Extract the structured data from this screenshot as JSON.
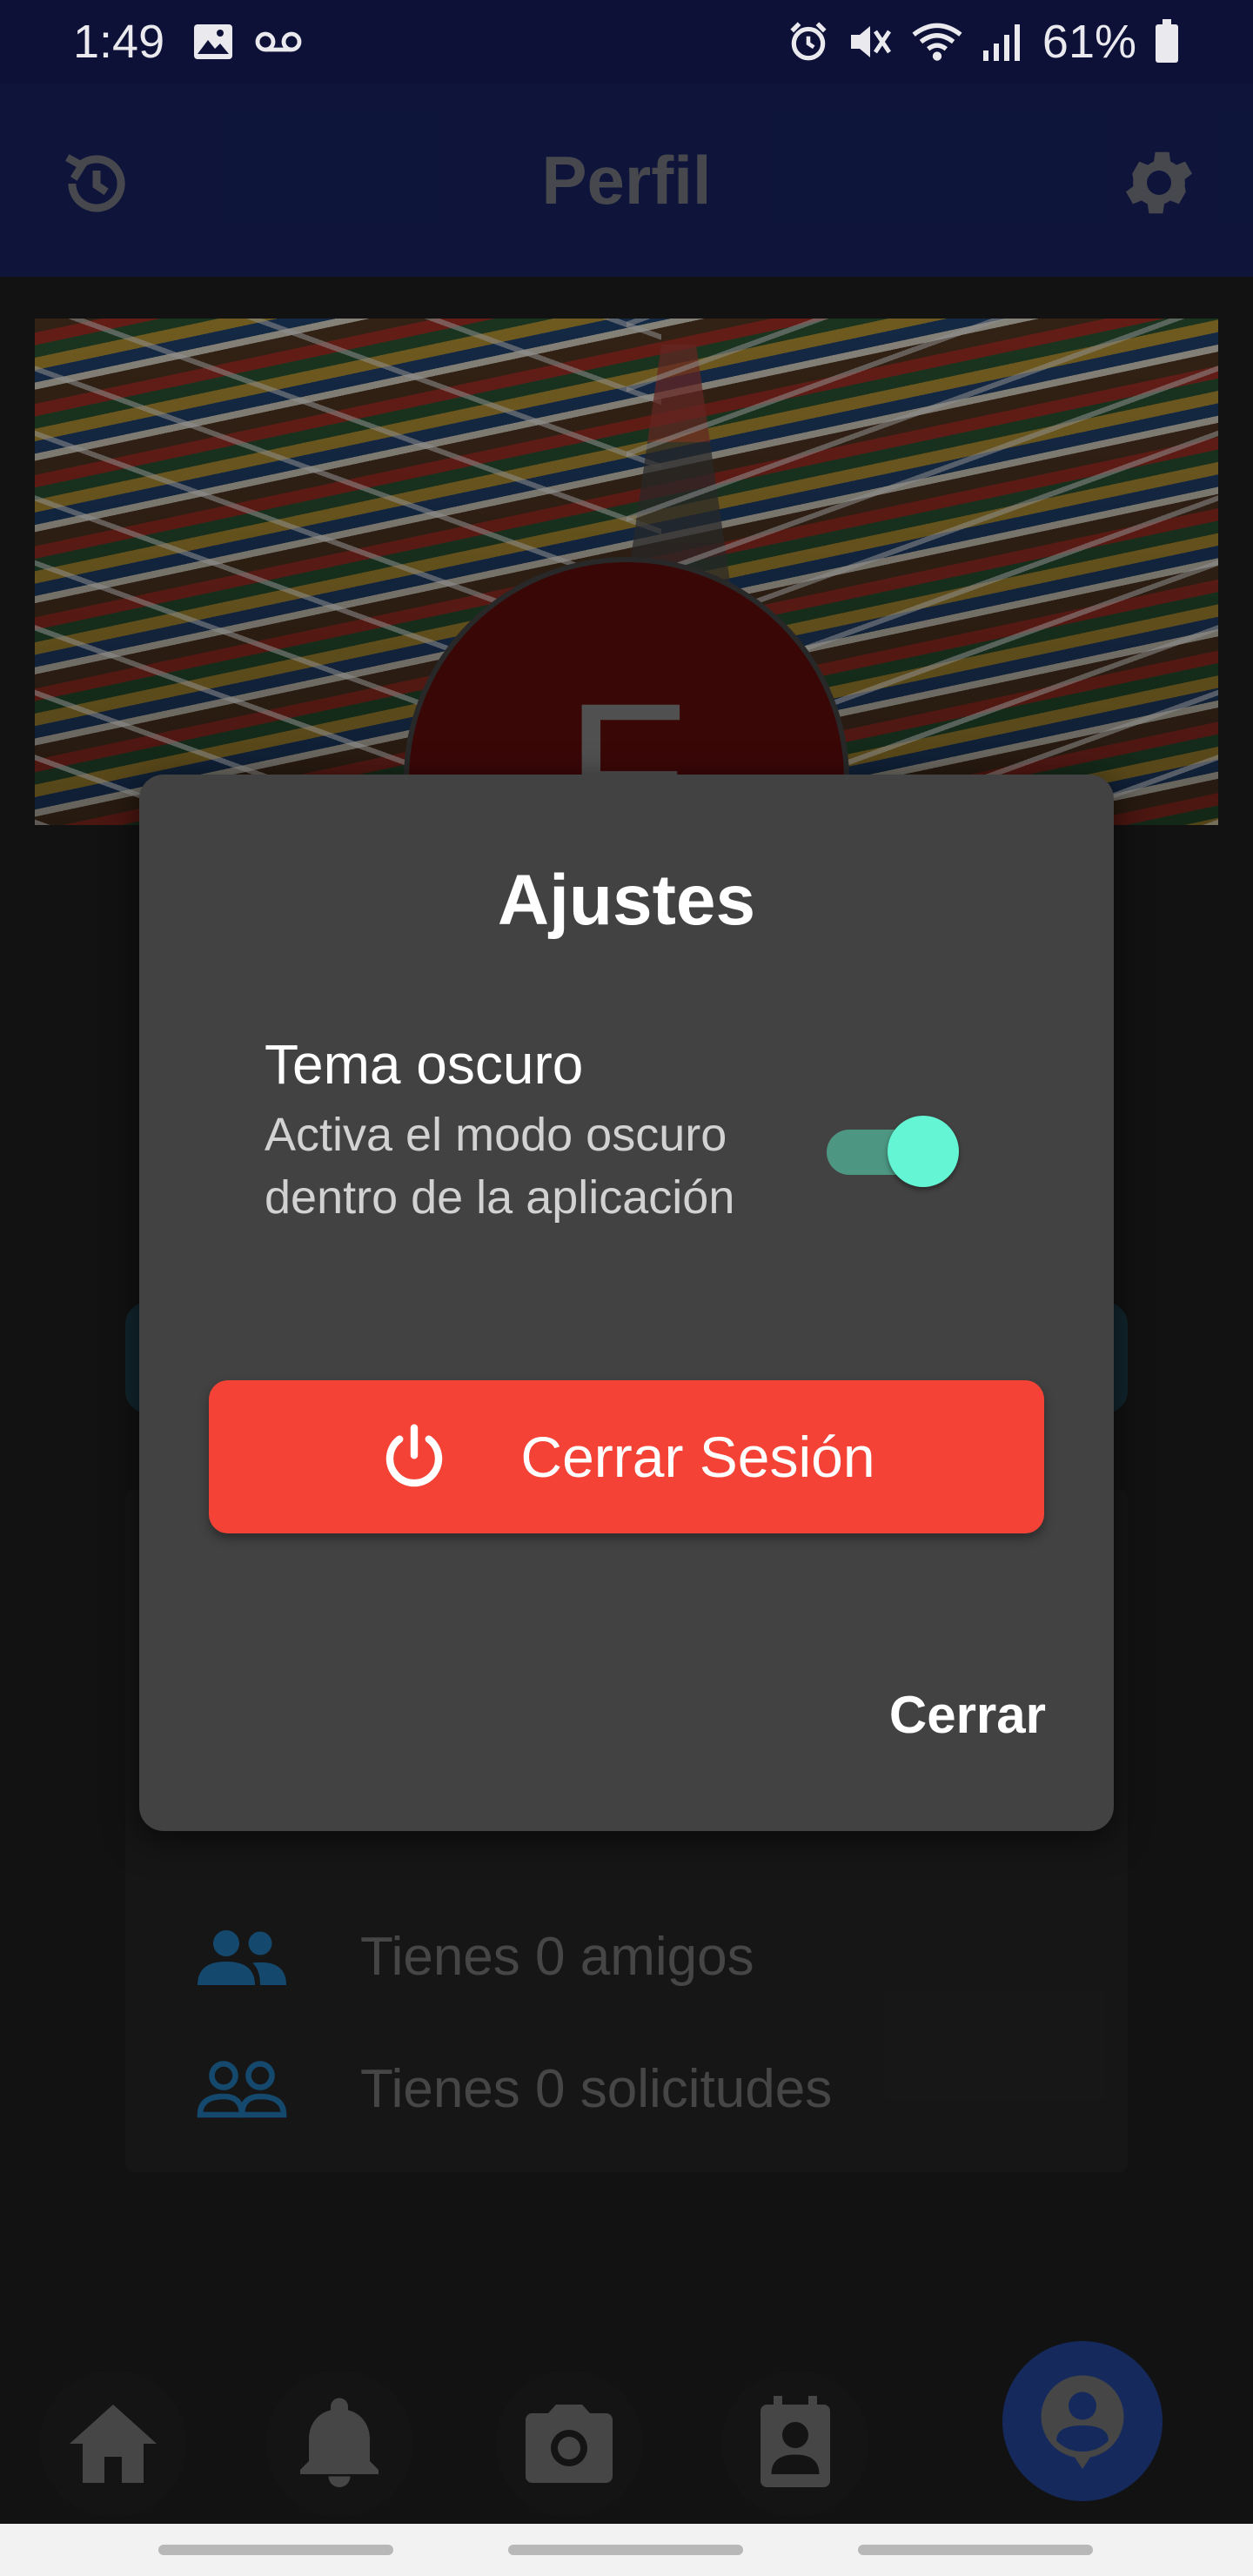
{
  "status_bar": {
    "time": "1:49",
    "battery_percent": "61%",
    "icons_left": [
      "image-icon",
      "voicemail-icon"
    ],
    "icons_right": [
      "alarm-icon",
      "mute-icon",
      "wifi-icon",
      "signal-icon",
      "battery-icon"
    ]
  },
  "header": {
    "title": "Perfil",
    "left_icon": "history-icon",
    "right_icon": "gear-icon"
  },
  "profile": {
    "avatar_initial": "F"
  },
  "stats": [
    {
      "icon": "group-icon",
      "label": "Tienes 0 amigos"
    },
    {
      "icon": "group-outline-icon",
      "label": "Tienes 0 solicitudes"
    }
  ],
  "dialog": {
    "title": "Ajustes",
    "option_title": "Tema oscuro",
    "option_description": "Activa el modo oscuro dentro de la aplicación",
    "toggle_on": true,
    "logout_label": "Cerrar Sesión",
    "close_label": "Cerrar"
  },
  "bottom_nav": [
    "home-icon",
    "bell-icon",
    "camera-icon",
    "contacts-icon",
    "profile-icon"
  ],
  "colors": {
    "header_bg": "#16205a",
    "status_bg": "#0d1138",
    "dialog_bg": "#424242",
    "logout_red": "#f44336",
    "toggle_thumb": "#64f5d4",
    "accent_blue": "#1f6fa8"
  }
}
